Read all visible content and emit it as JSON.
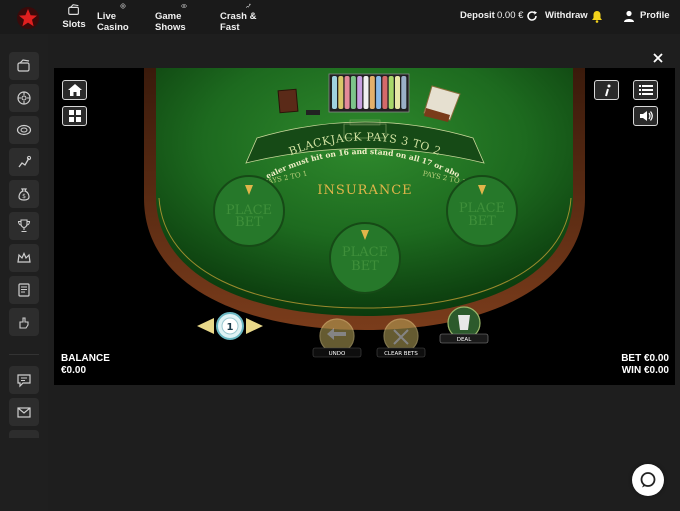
{
  "header": {
    "nav": [
      {
        "label": "Slots",
        "icon": "slots-icon"
      },
      {
        "label": "Live Casino",
        "icon": "live-casino-icon"
      },
      {
        "label": "Game Shows",
        "icon": "game-shows-icon"
      },
      {
        "label": "Crash & Fast",
        "icon": "crash-fast-icon"
      }
    ],
    "deposit_label": "Deposit",
    "deposit_amount": "0.00 €",
    "withdraw_label": "Withdraw",
    "profile_label": "Profile"
  },
  "sidebar": {
    "items": [
      "slots-icon",
      "live-casino-icon",
      "game-shows-icon",
      "crash-fast-icon",
      "money-bag-icon",
      "trophy-icon",
      "crown-icon",
      "book-icon",
      "hand-icon",
      "chat-icon",
      "mail-icon"
    ]
  },
  "game": {
    "table_text": {
      "blackjack": "BLACKJACK PAYS 3 TO 2",
      "dealer_rule": "Dealer must hit on 16 and stand on all 17 or above",
      "insurance": "INSURANCE",
      "pays_left": "PAYS 2 TO 1",
      "pays_right": "PAYS 2 TO 1"
    },
    "place_bet_line1": "PLACE",
    "place_bet_line2": "BET",
    "chip_value": "1",
    "undo_label": "UNDO",
    "clear_label": "CLEAR BETS",
    "deal_label": "DEAL",
    "balance_label": "BALANCE",
    "balance_value": "€0.00",
    "bet_label": "BET",
    "bet_value": "€0.00",
    "win_label": "WIN",
    "win_value": "€0.00"
  },
  "colors": {
    "felt": "#1f6a20",
    "felt_dark": "#0b3a0d",
    "rail": "#5a2b14",
    "accent_gold": "#e1b54a",
    "warning_yellow": "#f2d21b"
  }
}
